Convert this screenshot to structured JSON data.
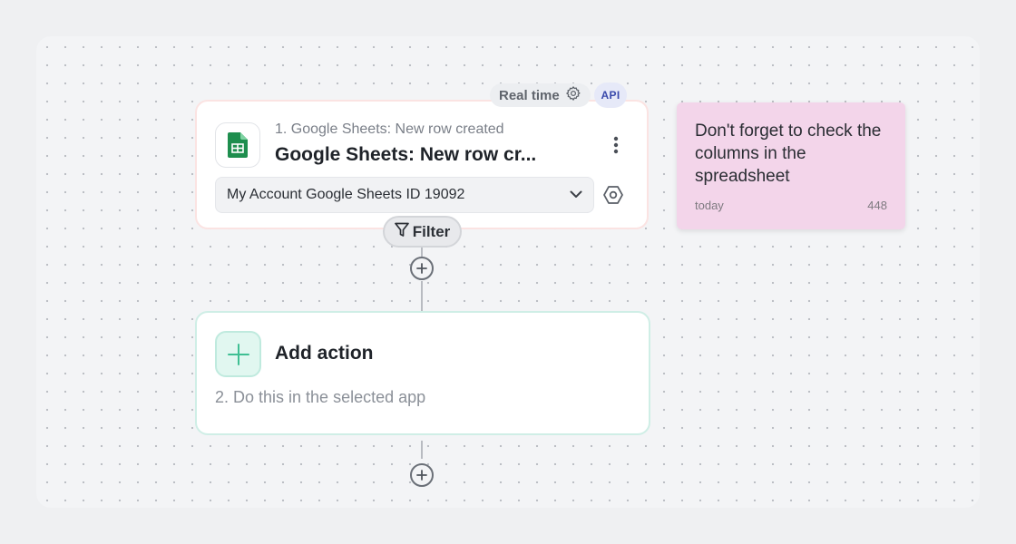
{
  "trigger": {
    "step_label": "1. Google Sheets: New row created",
    "title": "Google Sheets: New row cr...",
    "app_icon": "google-sheets-icon",
    "account": "My Account Google Sheets ID 19092",
    "badges": {
      "realtime": "Real time",
      "api": "API"
    }
  },
  "filter": {
    "label": "Filter"
  },
  "action": {
    "title": "Add action",
    "subtitle": "2. Do this in the selected app"
  },
  "note": {
    "text": "Don't forget to check the columns in the spreadsheet",
    "date": "today",
    "count": "448"
  },
  "colors": {
    "trigger_border": "#fbe3e2",
    "action_border": "#cfeee6",
    "action_accent": "#3fbf93",
    "sheets_green": "#1e8e4e",
    "note_bg": "#f3d5ea",
    "api_text": "#3949ab"
  }
}
